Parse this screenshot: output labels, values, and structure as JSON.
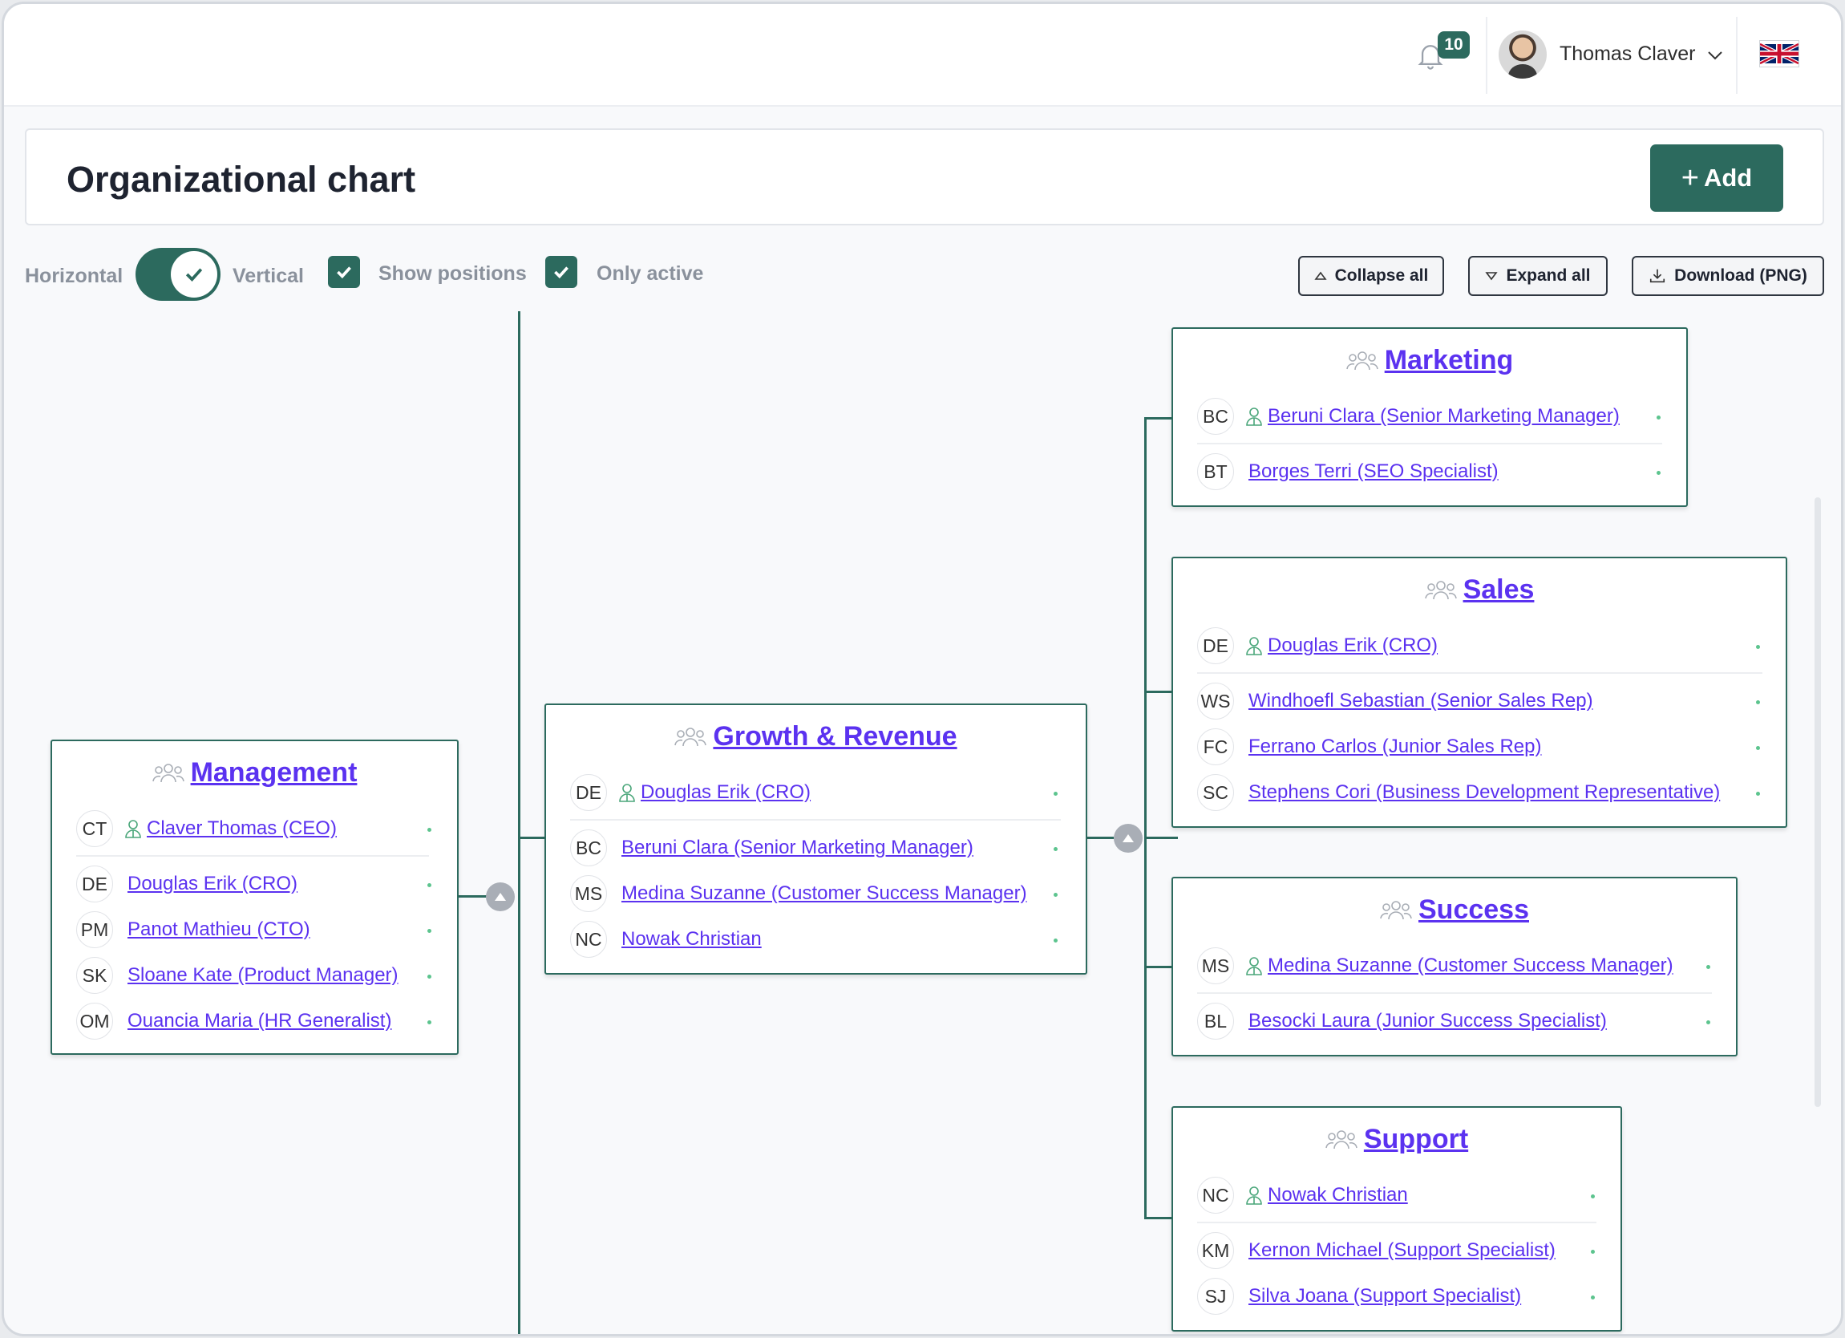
{
  "header": {
    "notifications_count": "10",
    "user_name": "Thomas Claver",
    "language": "en-GB"
  },
  "page": {
    "title": "Organizational chart",
    "add_label": "Add"
  },
  "toolbar": {
    "horizontal_label": "Horizontal",
    "vertical_label": "Vertical",
    "orientation": "vertical",
    "show_positions_label": "Show positions",
    "show_positions": true,
    "only_active_label": "Only active",
    "only_active": true,
    "collapse_label": "Collapse all",
    "expand_label": "Expand all",
    "download_label": "Download (PNG)"
  },
  "colors": {
    "brand": "#2c6a5e",
    "link": "#5b32f0",
    "active_dot": "#5cc48e"
  },
  "org": {
    "management": {
      "name": "Management",
      "members": [
        {
          "initials": "CT",
          "name": "Claver Thomas (CEO)",
          "manager": true
        },
        {
          "initials": "DE",
          "name": "Douglas Erik (CRO)"
        },
        {
          "initials": "PM",
          "name": "Panot Mathieu (CTO)"
        },
        {
          "initials": "SK",
          "name": "Sloane Kate (Product Manager)"
        },
        {
          "initials": "OM",
          "name": "Ouancia Maria (HR Generalist)"
        }
      ]
    },
    "growth": {
      "name": "Growth & Revenue",
      "members": [
        {
          "initials": "DE",
          "name": "Douglas Erik (CRO)",
          "manager": true
        },
        {
          "initials": "BC",
          "name": "Beruni Clara (Senior Marketing Manager)"
        },
        {
          "initials": "MS",
          "name": "Medina Suzanne (Customer Success Manager)"
        },
        {
          "initials": "NC",
          "name": "Nowak Christian"
        }
      ]
    },
    "marketing": {
      "name": "Marketing",
      "members": [
        {
          "initials": "BC",
          "name": "Beruni Clara (Senior Marketing Manager)",
          "manager": true
        },
        {
          "initials": "BT",
          "name": "Borges Terri (SEO Specialist)"
        }
      ]
    },
    "sales": {
      "name": "Sales",
      "members": [
        {
          "initials": "DE",
          "name": "Douglas Erik (CRO)",
          "manager": true
        },
        {
          "initials": "WS",
          "name": "Windhoefl Sebastian (Senior Sales Rep)"
        },
        {
          "initials": "FC",
          "name": "Ferrano Carlos (Junior Sales Rep)"
        },
        {
          "initials": "SC",
          "name": "Stephens Cori (Business Development Representative)"
        }
      ]
    },
    "success": {
      "name": "Success",
      "members": [
        {
          "initials": "MS",
          "name": "Medina Suzanne (Customer Success Manager)",
          "manager": true
        },
        {
          "initials": "BL",
          "name": "Besocki Laura (Junior Success Specialist)"
        }
      ]
    },
    "support": {
      "name": "Support",
      "members": [
        {
          "initials": "NC",
          "name": "Nowak Christian",
          "manager": true
        },
        {
          "initials": "KM",
          "name": "Kernon Michael (Support Specialist)"
        },
        {
          "initials": "SJ",
          "name": "Silva Joana (Support Specialist)"
        }
      ]
    }
  }
}
